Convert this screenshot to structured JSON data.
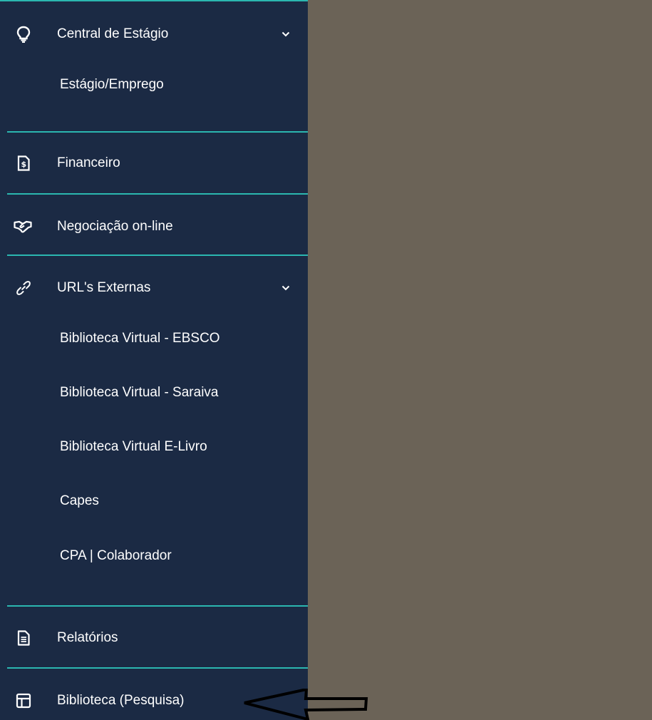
{
  "sidebar": {
    "accent_color": "#2bb7b0",
    "background_color": "#1b2a44",
    "groups": [
      {
        "label": "Central de Estágio",
        "icon": "lightbulb-icon",
        "expanded": true,
        "children": [
          "Estágio/Emprego"
        ]
      },
      {
        "label": "Financeiro",
        "icon": "invoice-dollar-icon"
      },
      {
        "label": "Negociação on-line",
        "icon": "handshake-icon"
      },
      {
        "label": "URL's Externas",
        "icon": "link-icon",
        "expanded": true,
        "children": [
          "Biblioteca Virtual - EBSCO",
          "Biblioteca Virtual - Saraiva",
          "Biblioteca Virtual E-Livro",
          "Capes",
          "CPA | Colaborador"
        ]
      },
      {
        "label": "Relatórios",
        "icon": "file-text-icon"
      },
      {
        "label": "Biblioteca (Pesquisa)",
        "icon": "layout-icon"
      }
    ]
  },
  "main": {
    "background_color": "#6b6357"
  },
  "annotation": {
    "icon": "pointer-arrow-icon"
  }
}
